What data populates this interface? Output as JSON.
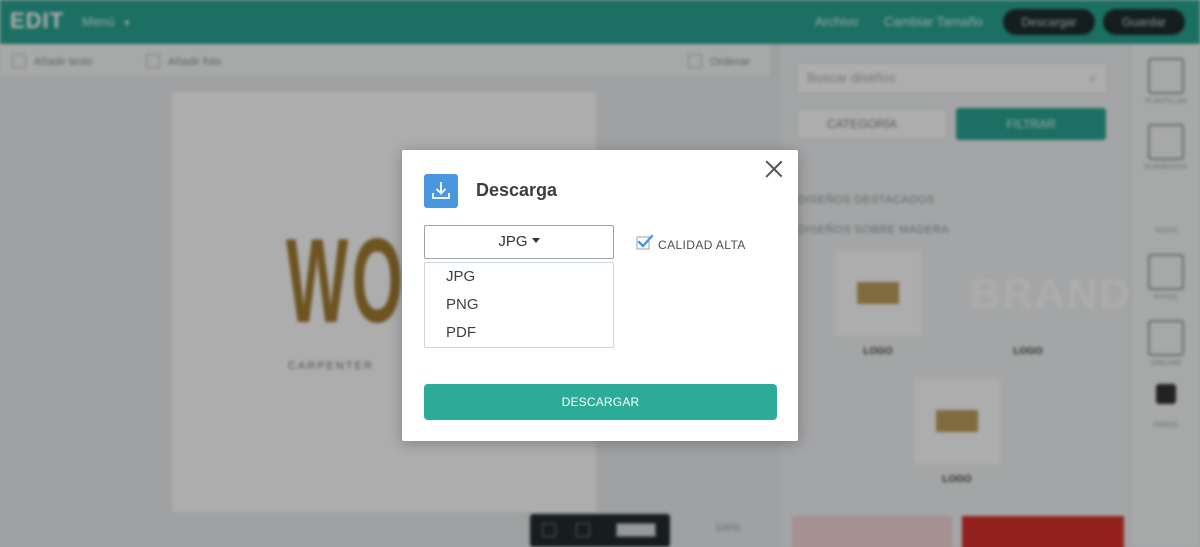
{
  "background": {
    "logo": "EDIT",
    "menu_label": "Menú",
    "header_links": [
      "Archivo",
      "Cambiar Tamaño"
    ],
    "header_buttons": [
      "Descargar",
      "Guardar"
    ],
    "toolbar": [
      "Añadir texto",
      "Añadir foto",
      "Ordenar"
    ],
    "artboard_title": "WOO",
    "artboard_subtitle": "CARPENTER",
    "zoom_label": "100%",
    "search_placeholder": "Buscar diseños",
    "category_select": "CATEGORÍA",
    "filter_button": "FILTRAR",
    "panel_headings": [
      "DISEÑOS DESTACADOS",
      "DISEÑOS SOBRE MADERA"
    ],
    "brand_text": "BRAND",
    "thumb_labels": [
      "LOGO",
      "LOGO",
      "LOGO"
    ],
    "rightbar_labels": [
      "PLANTILLAS",
      "ELEMENTOS",
      "TEXTO",
      "FOTOS",
      "DIBUJAR",
      "FONDO"
    ]
  },
  "modal": {
    "title": "Descarga",
    "format_selected": "JPG",
    "format_options": [
      "JPG",
      "PNG",
      "PDF"
    ],
    "quality_label": "CALIDAD ALTA",
    "quality_checked": true,
    "download_button": "DESCARGAR",
    "colors": {
      "accent": "#2cab98",
      "icon_bg": "#4a97e0",
      "check": "#4a97e0"
    }
  }
}
